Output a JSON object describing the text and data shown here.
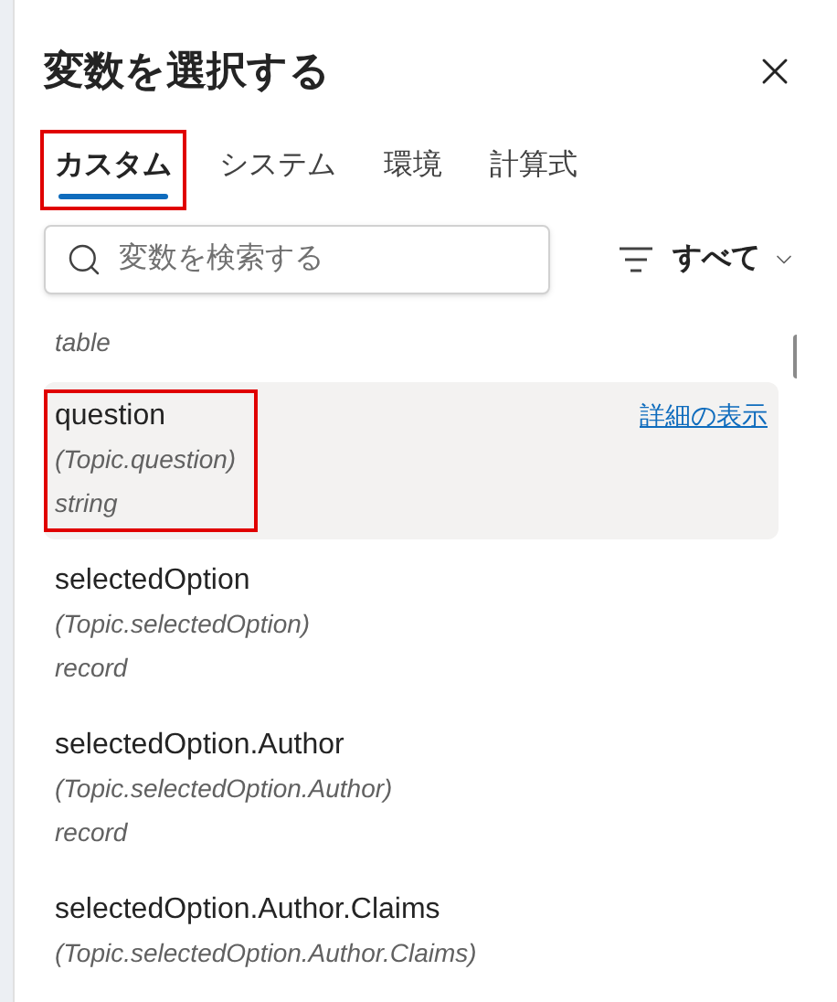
{
  "title": "変数を選択する",
  "tabs": [
    {
      "label": "カスタム",
      "selected": true,
      "annotated": true
    },
    {
      "label": "システム",
      "selected": false,
      "annotated": false
    },
    {
      "label": "環境",
      "selected": false,
      "annotated": false
    },
    {
      "label": "計算式",
      "selected": false,
      "annotated": false
    }
  ],
  "search": {
    "placeholder": "変数を検索する"
  },
  "filter": {
    "label": "すべて"
  },
  "variables": [
    {
      "type": "table",
      "selected": false,
      "annotated": false
    },
    {
      "name": "question",
      "path": "(Topic.question)",
      "type": "string",
      "selected": true,
      "annotated": true,
      "link": "詳細の表示"
    },
    {
      "name": "selectedOption",
      "path": "(Topic.selectedOption)",
      "type": "record",
      "selected": false,
      "annotated": false
    },
    {
      "name": "selectedOption.Author",
      "path": "(Topic.selectedOption.Author)",
      "type": "record",
      "selected": false,
      "annotated": false
    },
    {
      "name": "selectedOption.Author.Claims",
      "path": "(Topic.selectedOption.Author.Claims)",
      "selected": false,
      "annotated": false
    }
  ]
}
